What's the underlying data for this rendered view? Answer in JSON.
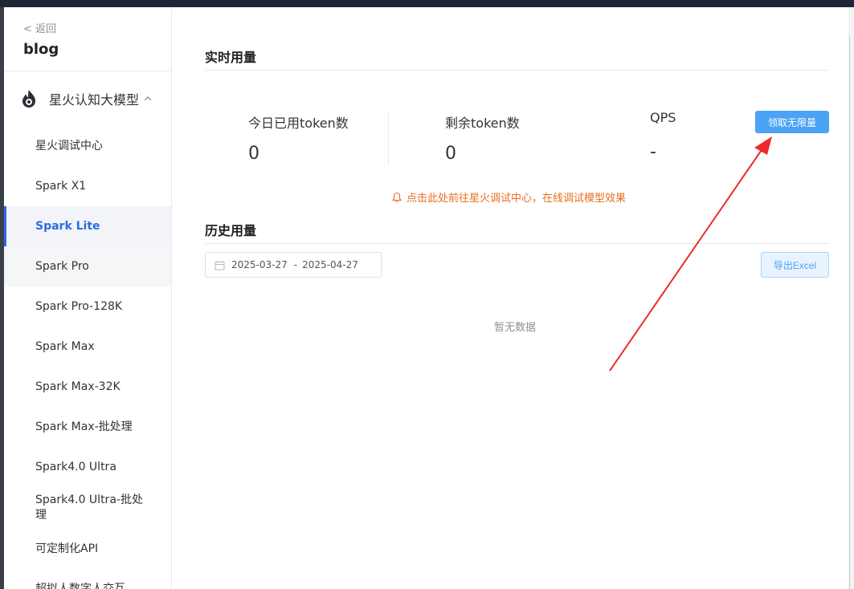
{
  "sidebar": {
    "back_label": "< 返回",
    "app_name": "blog",
    "group_label": "星火认知大模型",
    "items": [
      {
        "label": "星火调试中心"
      },
      {
        "label": "Spark X1"
      },
      {
        "label": "Spark Lite"
      },
      {
        "label": "Spark Pro"
      },
      {
        "label": "Spark Pro-128K"
      },
      {
        "label": "Spark Max"
      },
      {
        "label": "Spark Max-32K"
      },
      {
        "label": "Spark Max-批处理"
      },
      {
        "label": "Spark4.0 Ultra"
      },
      {
        "label": "Spark4.0 Ultra-批处理"
      },
      {
        "label": "可定制化API"
      },
      {
        "label": "超拟人数字人交互"
      }
    ],
    "active_item": "Spark Lite"
  },
  "realtime": {
    "title": "实时用量",
    "stats": [
      {
        "label": "今日已用token数",
        "value": "0"
      },
      {
        "label": "剩余token数",
        "value": "0"
      },
      {
        "label": "QPS",
        "value": "-"
      }
    ],
    "claim_button": "领取无限量",
    "notice": "点击此处前往星火调试中心，在线调试模型效果"
  },
  "history": {
    "title": "历史用量",
    "start_date": "2025-03-27",
    "range_separator": "-",
    "end_date": "2025-04-27",
    "export_button": "导出Excel",
    "empty_text": "暂无数据"
  },
  "colors": {
    "accent": "#2b6de5",
    "primary_button": "#4ba3f5",
    "notice": "#e8701e",
    "annotation_arrow": "#ee2b2b"
  }
}
